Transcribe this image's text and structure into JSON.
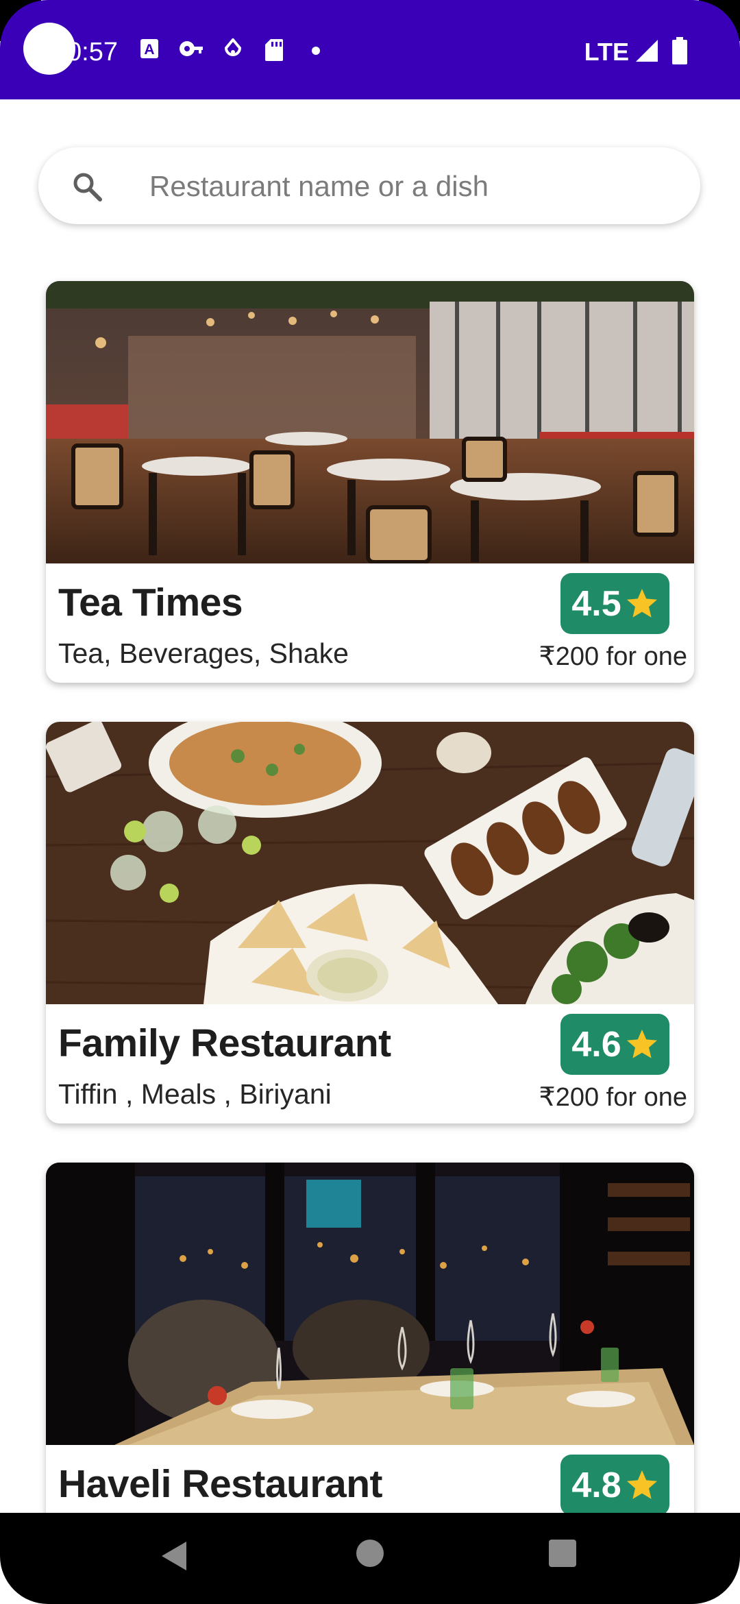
{
  "status_bar": {
    "time": "0:57",
    "network": "LTE",
    "icons": [
      "a-box-icon",
      "vpn-key-icon",
      "location-drop-icon",
      "sd-card-icon",
      "dot-icon",
      "signal-icon",
      "battery-icon"
    ]
  },
  "search": {
    "placeholder": "Restaurant name or a dish",
    "value": "",
    "icon": "search-icon"
  },
  "restaurants": [
    {
      "name": "Tea Times",
      "cuisine": "Tea, Beverages, Shake",
      "rating": "4.5",
      "price": "₹200 for one",
      "image": "restaurant-interior-photo"
    },
    {
      "name": "Family Restaurant",
      "cuisine": "Tiffin , Meals , Biriyani",
      "rating": "4.6",
      "price": "₹200 for one",
      "image": "food-table-photo"
    },
    {
      "name": "Haveli Restaurant",
      "rating": "4.8",
      "image": "night-dining-photo"
    }
  ],
  "colors": {
    "status_bar": "#3a00b8",
    "rating_badge": "#1f8c67",
    "star": "#f7c325",
    "nav_bar": "#000000"
  },
  "nav_bar": {
    "buttons": [
      "back-icon",
      "home-icon",
      "recents-icon"
    ]
  }
}
